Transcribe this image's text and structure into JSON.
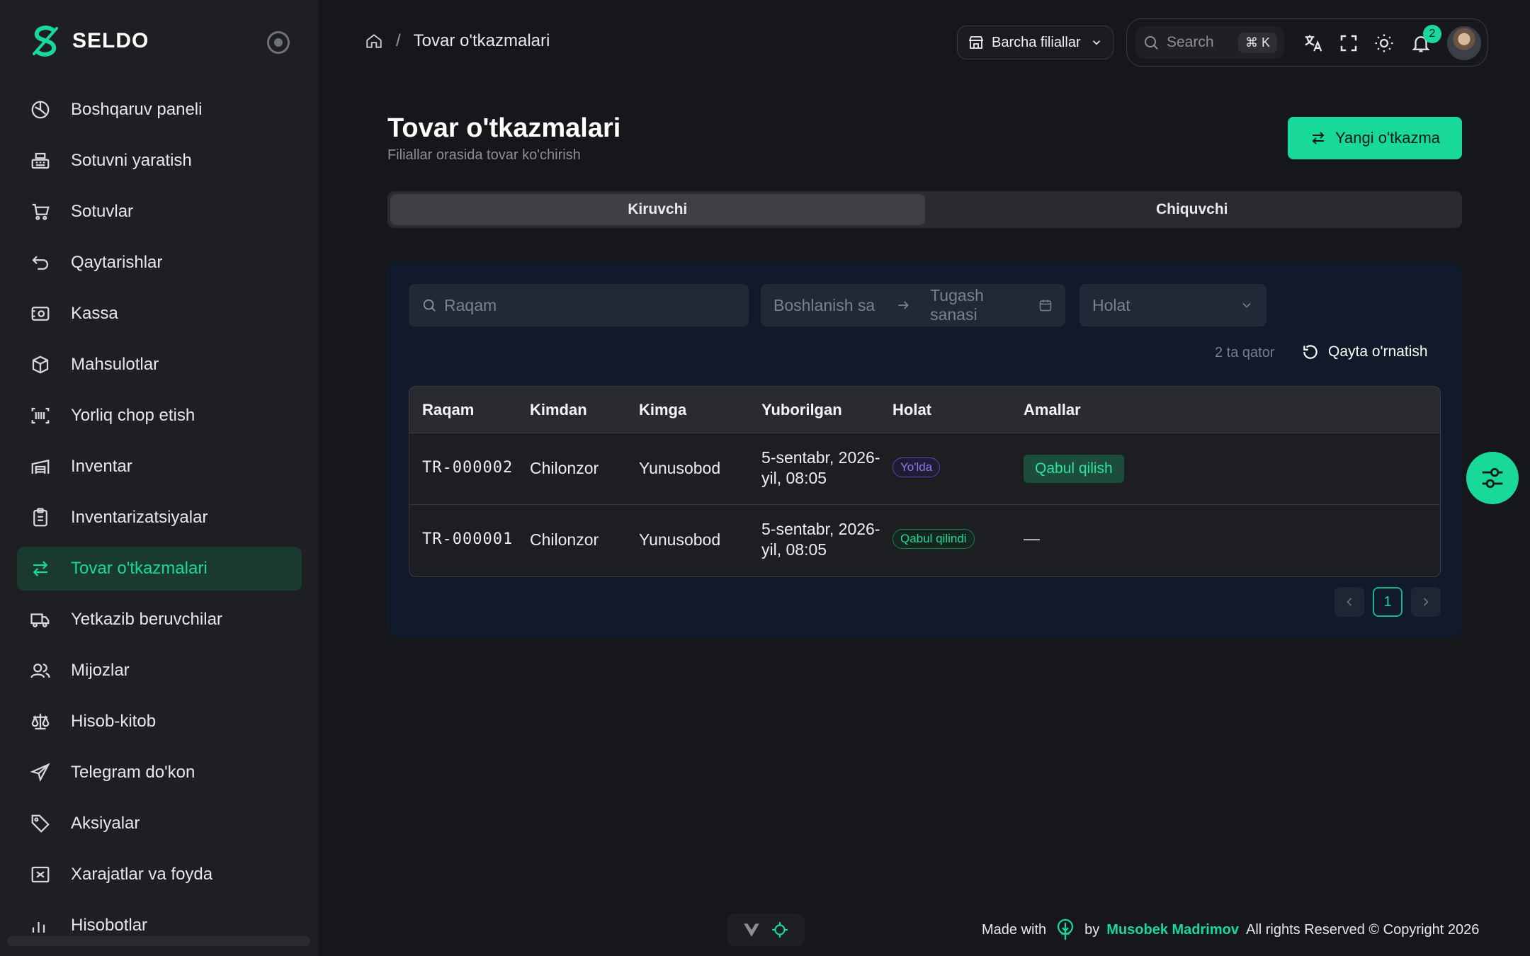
{
  "brand": {
    "name": "SELDO"
  },
  "sidebar": {
    "items": [
      {
        "label": "Boshqaruv paneli",
        "icon": "dashboard-icon"
      },
      {
        "label": "Sotuvni yaratish",
        "icon": "cash-register-icon"
      },
      {
        "label": "Sotuvlar",
        "icon": "cart-icon"
      },
      {
        "label": "Qaytarishlar",
        "icon": "return-icon"
      },
      {
        "label": "Kassa",
        "icon": "cashbox-icon"
      },
      {
        "label": "Mahsulotlar",
        "icon": "box-icon"
      },
      {
        "label": "Yorliq chop etish",
        "icon": "barcode-icon"
      },
      {
        "label": "Inventar",
        "icon": "warehouse-icon"
      },
      {
        "label": "Inventarizatsiyalar",
        "icon": "clipboard-icon"
      },
      {
        "label": "Tovar o'tkazmalari",
        "icon": "transfer-icon",
        "active": true
      },
      {
        "label": "Yetkazib beruvchilar",
        "icon": "truck-icon"
      },
      {
        "label": "Mijozlar",
        "icon": "users-icon"
      },
      {
        "label": "Hisob-kitob",
        "icon": "scale-icon"
      },
      {
        "label": "Telegram do'kon",
        "icon": "telegram-icon"
      },
      {
        "label": "Aksiyalar",
        "icon": "tag-icon"
      },
      {
        "label": "Xarajatlar va foyda",
        "icon": "expense-icon"
      },
      {
        "label": "Hisobotlar",
        "icon": "report-icon"
      }
    ]
  },
  "header": {
    "breadcrumb": "Tovar o'tkazmalari",
    "branch_select": "Barcha filiallar",
    "search_placeholder": "Search",
    "search_shortcut": "⌘ K",
    "notifications_count": "2"
  },
  "page": {
    "title": "Tovar o'tkazmalari",
    "subtitle": "Filiallar orasida tovar ko'chirish",
    "new_button": "Yangi o'tkazma",
    "tabs": [
      {
        "label": "Kiruvchi",
        "active": true
      },
      {
        "label": "Chiquvchi",
        "active": false
      }
    ]
  },
  "filters": {
    "number_placeholder": "Raqam",
    "start_date_placeholder": "Boshlanish sana",
    "end_date_placeholder": "Tugash sanasi",
    "status_placeholder": "Holat",
    "row_count": "2 ta qator",
    "reset": "Qayta o'rnatish"
  },
  "table": {
    "headers": [
      "Raqam",
      "Kimdan",
      "Kimga",
      "Yuborilgan",
      "Holat",
      "Amallar"
    ],
    "rows": [
      {
        "number": "TR-000002",
        "from": "Chilonzor",
        "to": "Yunusobod",
        "sent_line1": "5-sentabr, 2026-",
        "sent_line2": "yil, 08:05",
        "status": "Yo'lda",
        "action": "Qabul qilish"
      },
      {
        "number": "TR-000001",
        "from": "Chilonzor",
        "to": "Yunusobod",
        "sent_line1": "5-sentabr, 2026-",
        "sent_line2": "yil, 08:05",
        "status": "Qabul qilindi",
        "action": "—"
      }
    ]
  },
  "pagination": {
    "current": "1"
  },
  "footer": {
    "made_with": "Made with",
    "by": "by",
    "author": "Musobek Madrimov",
    "rights": "All rights Reserved © Copyright 2026"
  },
  "colors": {
    "accent": "#19d99a",
    "background": "#16171b",
    "sidebar": "#1e1f23",
    "card": "#111a2b"
  }
}
